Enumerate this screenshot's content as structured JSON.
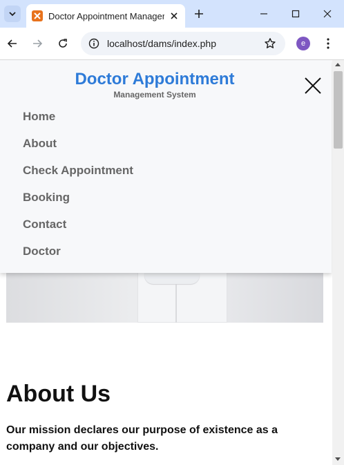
{
  "browser": {
    "tab_title": "Doctor Appointment Management System",
    "url": "localhost/dams/index.php",
    "profile_initial": "e"
  },
  "menu": {
    "brand_title": "Doctor Appointment",
    "brand_subtitle": "Management System",
    "items": [
      {
        "label": "Home"
      },
      {
        "label": "About"
      },
      {
        "label": "Check Appointment"
      },
      {
        "label": "Booking"
      },
      {
        "label": "Contact"
      },
      {
        "label": "Doctor"
      }
    ]
  },
  "about": {
    "title": "About Us",
    "text": "Our mission declares our purpose of existence as a company and our objectives."
  },
  "colors": {
    "brand": "#2e7bd8",
    "tabbar": "#d3e3fd",
    "menu_text": "#666666"
  }
}
